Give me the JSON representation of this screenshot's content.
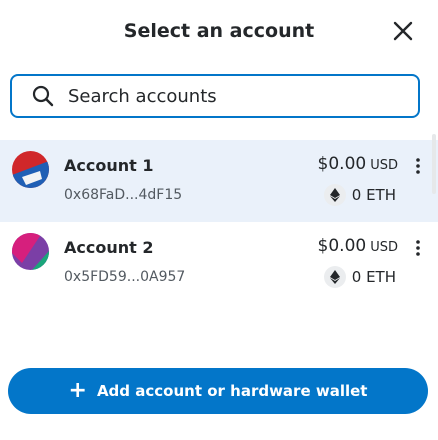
{
  "header": {
    "title": "Select an account",
    "close_icon": "close-icon"
  },
  "search": {
    "placeholder": "Search accounts",
    "value": "",
    "icon": "search-icon"
  },
  "accounts": [
    {
      "name": "Account 1",
      "address": "0x68FaD...4dF15",
      "balance": "$0.00",
      "currency": "USD",
      "token_amount": "0 ETH",
      "selected": true,
      "avatar_colors": [
        "#d0272a",
        "#f2f3f5",
        "#1f5fb5"
      ]
    },
    {
      "name": "Account 2",
      "address": "0x5FD59...0A957",
      "balance": "$0.00",
      "currency": "USD",
      "token_amount": "0 ETH",
      "selected": false,
      "avatar_colors": [
        "#7b3fa6",
        "#d61f7d",
        "#1aa57b"
      ]
    }
  ],
  "footer": {
    "add_label": "Add account or hardware wallet",
    "add_icon": "plus-icon"
  },
  "colors": {
    "accent": "#0376c9",
    "selected_row": "#eaf1fa"
  }
}
